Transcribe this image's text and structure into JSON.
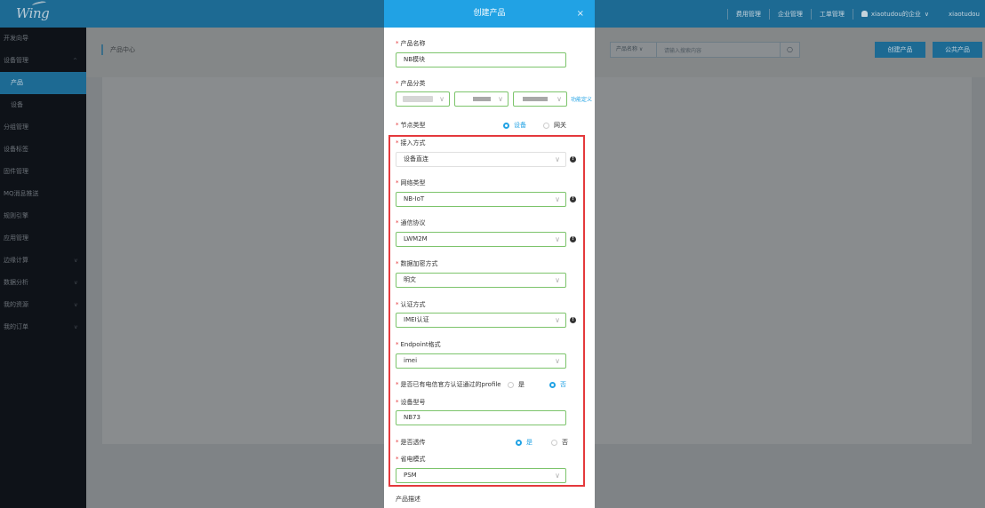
{
  "app": {
    "logo": "Wing",
    "topnav": {
      "fee_management": "费用管理",
      "enterprise_management": "企业管理",
      "ticket_management": "工单管理",
      "org_user": "xiaotudou的企业",
      "user": "xiaotudou"
    }
  },
  "sidebar": {
    "items": [
      {
        "label": "开发向导"
      },
      {
        "label": "设备管理"
      },
      {
        "label": "产品"
      },
      {
        "label": "设备"
      },
      {
        "label": "分组管理"
      },
      {
        "label": "设备标签"
      },
      {
        "label": "固件管理"
      },
      {
        "label": "MQ消息推送"
      },
      {
        "label": "规则引擎"
      },
      {
        "label": "应用管理"
      },
      {
        "label": "边缘计算"
      },
      {
        "label": "数据分析"
      },
      {
        "label": "我的资源"
      },
      {
        "label": "我的订单"
      }
    ]
  },
  "main": {
    "breadcrumb": "产品中心",
    "search_select": "产品名称",
    "search_placeholder": "请输入搜索内容",
    "create_button": "创建产品",
    "public_button": "公共产品"
  },
  "modal": {
    "title": "创建产品",
    "close": "×",
    "product_name": {
      "label": "产品名称",
      "value": "NB模块"
    },
    "category": {
      "label": "产品分类",
      "link": "功能定义"
    },
    "node_type": {
      "label": "节点类型",
      "options": [
        "设备",
        "网关"
      ],
      "selected": "设备"
    },
    "access_method": {
      "label": "接入方式",
      "value": "设备直连"
    },
    "network_type": {
      "label": "网络类型",
      "value": "NB-IoT"
    },
    "protocol": {
      "label": "通信协议",
      "value": "LWM2M"
    },
    "encryption": {
      "label": "数据加密方式",
      "value": "明文"
    },
    "auth_method": {
      "label": "认证方式",
      "value": "IMEI认证"
    },
    "endpoint_format": {
      "label": "Endpoint格式",
      "value": "imei"
    },
    "telecom_profile": {
      "label": "是否已有电信官方认证通过的profile",
      "options": [
        "是",
        "否"
      ],
      "selected": "否"
    },
    "device_model": {
      "label": "设备型号",
      "value": "NB73"
    },
    "passthrough": {
      "label": "是否透传",
      "options": [
        "是",
        "否"
      ],
      "selected": "是"
    },
    "power_mode": {
      "label": "省电模式",
      "value": "PSM"
    },
    "description": {
      "label": "产品描述"
    }
  }
}
